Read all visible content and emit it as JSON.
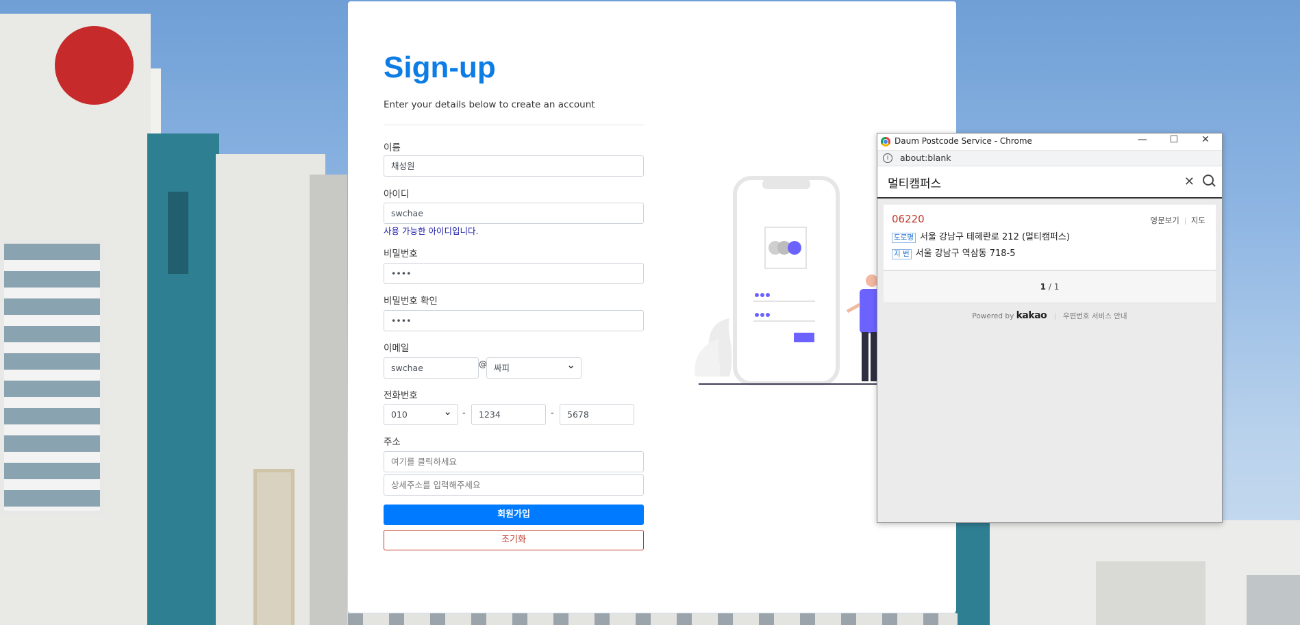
{
  "signup": {
    "title": "Sign-up",
    "subtitle": "Enter your details below to create an account",
    "name": {
      "label": "이름",
      "value": "채성원"
    },
    "userid": {
      "label": "아이디",
      "value": "swchae",
      "message": "사용 가능한 아이디입니다."
    },
    "password": {
      "label": "비밀번호",
      "value": "••••"
    },
    "password_confirm": {
      "label": "비밀번호 확인",
      "value": "••••"
    },
    "email": {
      "label": "이메일",
      "local": "swchae",
      "at": "@",
      "domain": "싸피"
    },
    "phone": {
      "label": "전화번호",
      "prefix": "010",
      "middle": "1234",
      "last": "5678",
      "dash": "-"
    },
    "address": {
      "label": "주소",
      "placeholder": "여기를 클릭하세요",
      "detail_placeholder": "상세주소를 입력해주세요"
    },
    "submit_label": "회원가입",
    "reset_label": "조기화"
  },
  "popup": {
    "window_title": "Daum Postcode Service - Chrome",
    "controls": {
      "minimize": "—",
      "maximize": "☐",
      "close": "✕"
    },
    "url": "about:blank",
    "query": "멀티캠퍼스",
    "result": {
      "zipcode": "06220",
      "road_tag": "도로명",
      "road_address": "서울 강남구 테헤란로 212 (멀티캠퍼스)",
      "jibun_tag": "지 번",
      "jibun_address": "서울 강남구 역삼동 718-5",
      "english_link": "영문보기",
      "map_link": "지도"
    },
    "pagination": {
      "current": "1",
      "separator": "/",
      "total": "1"
    },
    "footer": {
      "powered_by": "Powered by",
      "brand": "kakao",
      "guide": "우편번호 서비스 안내"
    }
  },
  "colors": {
    "accent": "#007bff",
    "title": "#0d7de6",
    "danger": "#c0392b",
    "illustration": "#6c63ff"
  },
  "icons": {
    "search": "search-icon",
    "clear": "close-icon",
    "info": "info-icon",
    "browser": "chrome-icon"
  }
}
